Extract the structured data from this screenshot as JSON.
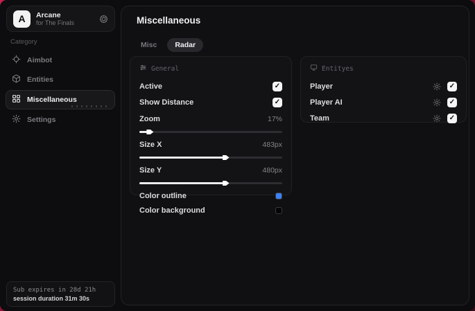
{
  "app": {
    "name": "Arcane",
    "subtitle": "for The Finals"
  },
  "icons": {
    "check_glyph": "✓",
    "logo_letter": "A"
  },
  "sidebar": {
    "category_label": "Category",
    "items": [
      {
        "label": "Aimbot",
        "active": false
      },
      {
        "label": "Entities",
        "active": false
      },
      {
        "label": "Miscellaneous",
        "active": true
      },
      {
        "label": "Settings",
        "active": false
      }
    ],
    "subscription": {
      "line1": "Sub expires in 28d 21h",
      "line2": "session duration 31m 30s"
    }
  },
  "header": {
    "title": "Miscellaneous",
    "tabs": [
      {
        "label": "Misc",
        "active": false
      },
      {
        "label": "Radar",
        "active": true
      }
    ]
  },
  "panels": {
    "general": {
      "title": "General",
      "toggles": [
        {
          "label": "Active",
          "checked": true
        },
        {
          "label": "Show Distance",
          "checked": true
        }
      ],
      "sliders": [
        {
          "label": "Zoom",
          "value": "17%",
          "percent": 6
        },
        {
          "label": "Size X",
          "value": "483px",
          "percent": 59
        },
        {
          "label": "Size Y",
          "value": "480px",
          "percent": 59
        }
      ],
      "colors": [
        {
          "label": "Color outline",
          "color": "#3b82f6"
        },
        {
          "label": "Color background",
          "color": "#050505"
        }
      ]
    },
    "entities": {
      "title": "Entityes",
      "rows": [
        {
          "label": "Player",
          "checked": true
        },
        {
          "label": "Player AI",
          "checked": true
        },
        {
          "label": "Team",
          "checked": true
        }
      ]
    }
  },
  "theme": {
    "accent_red": "#c81f4e",
    "swatch_blue": "#3b82f6",
    "swatch_black": "#050505"
  }
}
